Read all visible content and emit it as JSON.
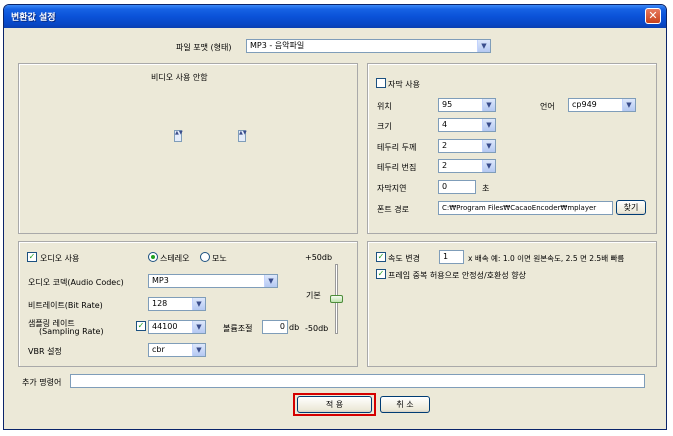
{
  "window": {
    "title": "변환값 설정",
    "close_glyph": "✕"
  },
  "format": {
    "label": "파일 포맷 (형태)",
    "value": "MP3 - 음악파일"
  },
  "video": {
    "title": "비디오 사용 안함",
    "spin_glyph": "▲▼"
  },
  "subtitle": {
    "enable_label": "자막 사용",
    "enabled": false,
    "position_label": "위치",
    "position_value": "95",
    "language_label": "언어",
    "language_value": "cp949",
    "size_label": "크기",
    "size_value": "4",
    "border_width_label": "테두리 두께",
    "border_width_value": "2",
    "border_blur_label": "테두리 번짐",
    "border_blur_value": "2",
    "delay_label": "자막지연",
    "delay_value": "0",
    "delay_unit": "초",
    "font_path_label": "폰트 경로",
    "font_path_value": "C:₩Program Files₩CacaoEncoder₩mplayer",
    "browse_label": "찾기"
  },
  "audio": {
    "enable_label": "오디오 사용",
    "enabled": true,
    "stereo_label": "스테레오",
    "mono_label": "모노",
    "channel_selected": "stereo",
    "codec_label": "오디오 코덱(Audio Codec)",
    "codec_value": "MP3",
    "bitrate_label": "비트레이트(Bit Rate)",
    "bitrate_value": "128",
    "samplerate_label_1": "샘플링 레이트",
    "samplerate_label_2": "(Sampling Rate)",
    "samplerate_checked": true,
    "samplerate_value": "44100",
    "volume_label": "볼륨조절",
    "volume_value": "0",
    "volume_unit": "db",
    "vbr_label": "VBR 설정",
    "vbr_value": "cbr",
    "slider_max": "+50db",
    "slider_default": "기본",
    "slider_min": "-50db",
    "slider_level": 0.5
  },
  "speed": {
    "change_label": "속도 변경",
    "change_checked": true,
    "speed_value": "1",
    "speed_suffix": "x 배속  예: 1.0 이면 원본속도, 2.5 면 2.5배 빠름",
    "frame_dup_label": "프레임 중복 허용으로 안정성/호환성 향상",
    "frame_dup_checked": true
  },
  "extra": {
    "label": "추가 명령어",
    "value": ""
  },
  "buttons": {
    "apply": "적 용",
    "cancel": "취 소"
  },
  "colors": {
    "title_bar": "#0a52d8",
    "dialog_bg": "#ece9d8",
    "highlight": "#d40000",
    "check": "#21a121"
  }
}
